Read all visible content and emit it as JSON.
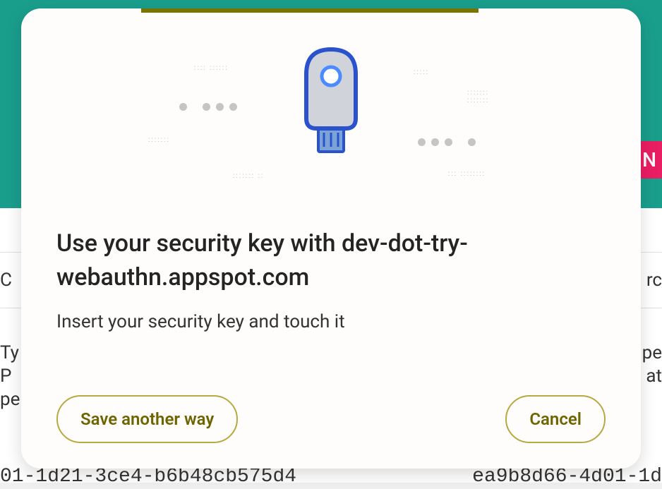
{
  "dialog": {
    "title": "Use your security key with dev-dot-try-webauthn.appspot.com",
    "subtitle": "Insert your security key and touch it",
    "actions": {
      "save_another_way": "Save another way",
      "cancel": "Cancel"
    }
  },
  "background": {
    "label_credentials_left": "C",
    "label_credentials_right": "rc",
    "label_type_left": "Ty",
    "label_type_right": "pe",
    "label_p_left": "P",
    "label_p_right": "at",
    "label_pe": "pe",
    "id_left": "01-1d21-3ce4-b6b48cb575d4",
    "id_right": "ea9b8d66-4d01-1d",
    "pink_badge": "N"
  }
}
